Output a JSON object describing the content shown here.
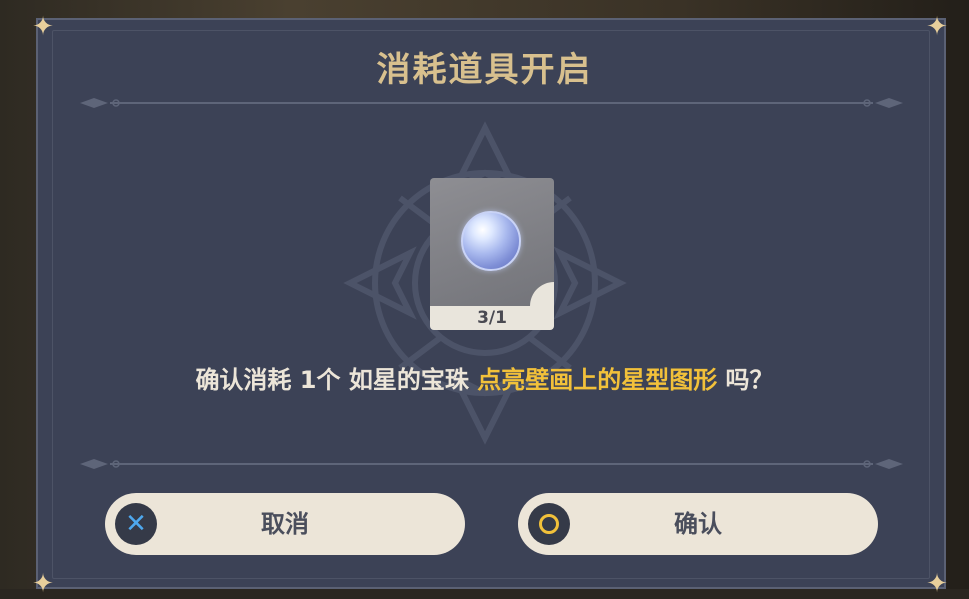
{
  "dialog": {
    "title": "消耗道具开启",
    "item": {
      "icon": "blue-pearl-orb",
      "count": "3/1"
    },
    "message": {
      "prefix": "确认消耗 1个 如星的宝珠 ",
      "highlight": "点亮壁画上的星型图形",
      "suffix": " 吗？"
    },
    "buttons": {
      "cancel_label": "取消",
      "cancel_icon": "cross-button-icon",
      "confirm_label": "确认",
      "confirm_icon": "circle-button-icon"
    }
  },
  "colors": {
    "panel": "#3c4256",
    "title": "#d8c08e",
    "text": "#ece5d8",
    "highlight": "#f2c13a",
    "button_bg": "#ece5d8",
    "cancel_icon": "#4ea8ee",
    "confirm_icon": "#f2c13a"
  }
}
